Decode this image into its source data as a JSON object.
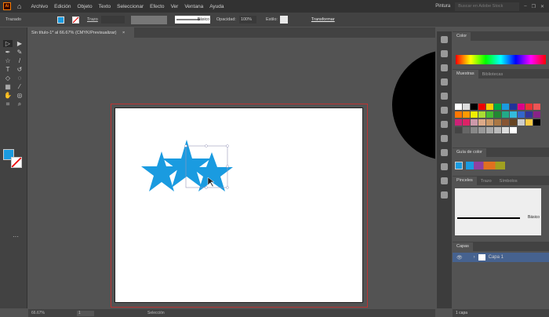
{
  "app": {
    "logo": "Ai",
    "menu": [
      "Archivo",
      "Edición",
      "Objeto",
      "Texto",
      "Seleccionar",
      "Efecto",
      "Ver",
      "Ventana",
      "Ayuda"
    ],
    "workspace": "Pintura",
    "stock_search_placeholder": "Buscar en Adobe Stock"
  },
  "control": {
    "mode": "Trazado",
    "stroke_label": "Trazo",
    "brush": "Básico",
    "opacity_label": "Opacidad:",
    "opacity": "100%",
    "style_label": "Estilo:",
    "transform": "Transformar"
  },
  "document": {
    "tab": "Sin título-1* al 66.67% (CMYK/Previsualizar)",
    "close": "×"
  },
  "panels": {
    "color": "Color",
    "swatches": "Muestras",
    "libraries": "Bibliotecas",
    "color_guide": "Guía de color",
    "brushes": "Pinceles",
    "stroke": "Trazo",
    "symbols": "Símbolos",
    "brush_basic": "Básico",
    "layers": "Capas",
    "layer_name": "Capa 1",
    "layer_count": "1 capa"
  },
  "status": {
    "zoom": "66.67%",
    "artboard": "1",
    "tool": "Selección"
  },
  "colors": {
    "fill": "#1a9be0",
    "accent": "#ff7c00"
  },
  "tools": [
    "selection",
    "direct-selection",
    "pen",
    "curvature",
    "star",
    "pencil",
    "type",
    "rotate",
    "eraser",
    "lasso",
    "gradient",
    "eyedropper",
    "puppet",
    "shape-builder",
    "artboard",
    "zoom"
  ]
}
